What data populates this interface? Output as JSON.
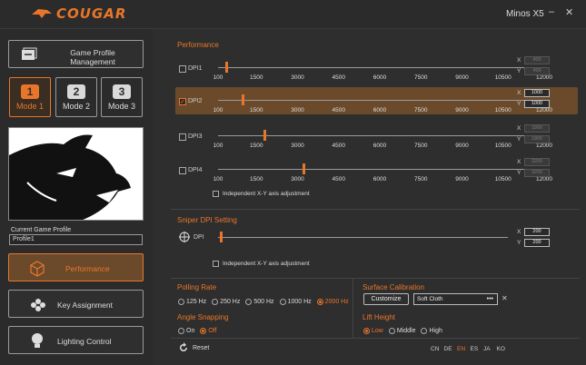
{
  "app": {
    "brand": "COUGAR",
    "device": "Minos X5",
    "minimize": "–",
    "close": "✕"
  },
  "sidebar": {
    "game_profile_btn": "Game Profile Management",
    "modes": [
      {
        "num": "1",
        "label": "Mode 1"
      },
      {
        "num": "2",
        "label": "Mode 2"
      },
      {
        "num": "3",
        "label": "Mode 3"
      }
    ],
    "current_profile_label": "Current Game Profile",
    "current_profile_value": "Profile1",
    "nav": [
      {
        "label": "Performance"
      },
      {
        "label": "Key Assignment"
      },
      {
        "label": "Lighting Control"
      }
    ]
  },
  "performance": {
    "title": "Performance",
    "ticks": [
      "100",
      "1500",
      "3000",
      "4500",
      "6000",
      "7500",
      "9000",
      "10500",
      "12000"
    ],
    "dpis": [
      {
        "label": "DPI1",
        "value": 400,
        "checked": false,
        "x": "400",
        "y": "400"
      },
      {
        "label": "DPI2",
        "value": 1000,
        "checked": true,
        "x": "1000",
        "y": "1000"
      },
      {
        "label": "DPI3",
        "value": 1800,
        "checked": false,
        "x": "1800",
        "y": "1800"
      },
      {
        "label": "DPI4",
        "value": 3200,
        "checked": false,
        "x": "3200",
        "y": "3200"
      }
    ],
    "x_label": "X",
    "y_label": "Y",
    "independent": "Independent X-Y axis adjustment"
  },
  "sniper": {
    "title": "Sniper DPI Setting",
    "label": "DPI",
    "value": 200,
    "x": "200",
    "y": "200",
    "independent": "Independent X-Y axis adjustment"
  },
  "polling": {
    "title": "Polling Rate",
    "options": [
      "125 Hz",
      "250 Hz",
      "500 Hz",
      "1000 Hz",
      "2000 Hz"
    ],
    "selected": 4
  },
  "angle": {
    "title": "Angle Snapping",
    "options": [
      "On",
      "Off"
    ],
    "selected": 1
  },
  "surface": {
    "title": "Surface Calibration",
    "customize": "Customize",
    "value": "Soft Cloth",
    "more": "•••",
    "clear": "✕"
  },
  "lift": {
    "title": "Lift Height",
    "options": [
      "Low",
      "Middle",
      "High"
    ],
    "selected": 0
  },
  "footer": {
    "reset": "Reset",
    "languages": [
      "CN",
      "DE",
      "EN",
      "ES",
      "JA",
      "KO"
    ],
    "selected_lang": 2
  },
  "colors": {
    "accent": "#e8762a",
    "bg": "#2e2e2e"
  }
}
